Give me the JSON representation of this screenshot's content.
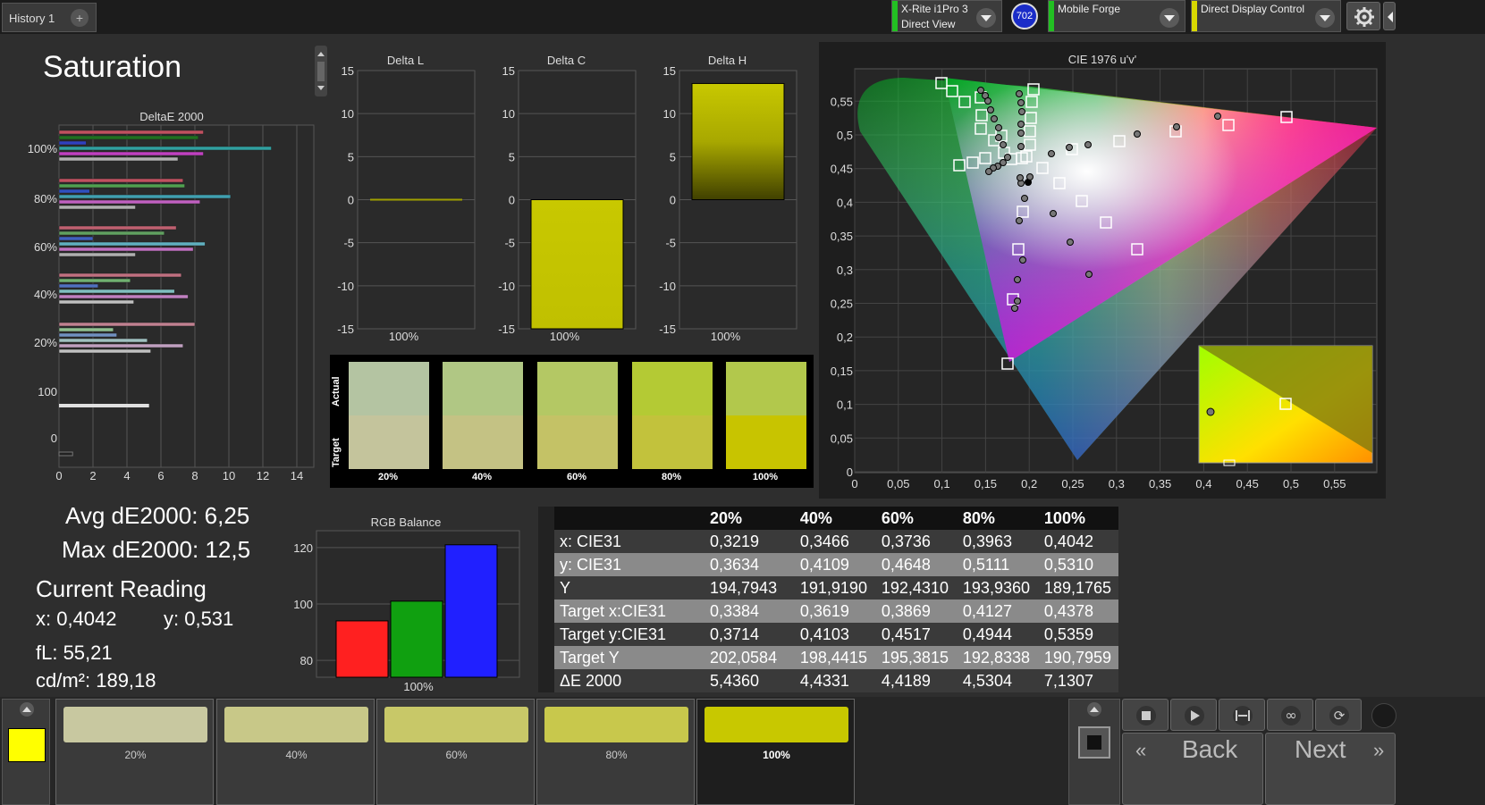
{
  "tabs": {
    "history": "History 1",
    "add": "+"
  },
  "devices": [
    {
      "line1": "X-Rite i1Pro 3",
      "line2": "Direct View",
      "color": "#22c022"
    },
    {
      "line1": "Mobile Forge",
      "line2": "",
      "color": "#22c022"
    },
    {
      "line1": "Direct Display Control",
      "line2": "",
      "color": "#d8d800"
    }
  ],
  "badge": "702",
  "icons": {
    "settings": "gear-icon",
    "collapse": "chevron-left-icon"
  },
  "page_title": "Saturation",
  "deltae_chart": {
    "title": "DeltaE 2000",
    "ylabels": [
      "100%",
      "80%",
      "60%",
      "40%",
      "20%",
      "100",
      "0"
    ],
    "xticks": [
      "0",
      "2",
      "4",
      "6",
      "8",
      "10",
      "12",
      "14"
    ]
  },
  "delta_charts": [
    {
      "title": "Delta L",
      "value": 0,
      "label": "100%"
    },
    {
      "title": "Delta C",
      "value": -15,
      "label": "100%"
    },
    {
      "title": "Delta H",
      "value": 13.5,
      "label": "100%"
    }
  ],
  "delta_ticks": [
    "15",
    "10",
    "5",
    "0",
    "-5",
    "-10",
    "-15"
  ],
  "swatch_compare": {
    "actual_label": "Actual",
    "target_label": "Target",
    "items": [
      {
        "label": "20%",
        "actual": "#b4c4a2",
        "target": "#c4c49c"
      },
      {
        "label": "40%",
        "actual": "#b0c784",
        "target": "#c4c284"
      },
      {
        "label": "60%",
        "actual": "#b4c864",
        "target": "#c4c266"
      },
      {
        "label": "80%",
        "actual": "#b4ca34",
        "target": "#c2c23c"
      },
      {
        "label": "100%",
        "actual": "#b2c84c",
        "target": "#c8c400"
      }
    ]
  },
  "cie": {
    "title": "CIE 1976 u'v'",
    "yticks": [
      "0,55",
      "0,5",
      "0,45",
      "0,4",
      "0,35",
      "0,3",
      "0,25",
      "0,2",
      "0,15",
      "0,1",
      "0,05",
      "0"
    ],
    "xticks": [
      "0",
      "0,05",
      "0,1",
      "0,15",
      "0,2",
      "0,25",
      "0,3",
      "0,35",
      "0,4",
      "0,45",
      "0,5",
      "0,55"
    ]
  },
  "stats": {
    "avg": "Avg dE2000: 6,25",
    "max": "Max dE2000: 12,5",
    "current_reading": "Current Reading",
    "x": "x: 0,4042",
    "y": "y: 0,531",
    "fl": "fL: 55,21",
    "cdm2": "cd/m²: 189,18"
  },
  "rgb_balance": {
    "title": "RGB Balance",
    "yticks": [
      "120",
      "100",
      "80"
    ],
    "label": "100%",
    "values": [
      {
        "name": "R",
        "value": 94,
        "color": "#ff2020"
      },
      {
        "name": "G",
        "value": 101,
        "color": "#10a010"
      },
      {
        "name": "B",
        "value": 121,
        "color": "#2020ff"
      }
    ]
  },
  "table": {
    "headers": [
      "",
      "20%",
      "40%",
      "60%",
      "80%",
      "100%"
    ],
    "rows": [
      [
        "x: CIE31",
        "0,3219",
        "0,3466",
        "0,3736",
        "0,3963",
        "0,4042"
      ],
      [
        "y: CIE31",
        "0,3634",
        "0,4109",
        "0,4648",
        "0,5111",
        "0,5310"
      ],
      [
        "Y",
        "194,7943",
        "191,9190",
        "192,4310",
        "193,9360",
        "189,1765"
      ],
      [
        "Target x:CIE31",
        "0,3384",
        "0,3619",
        "0,3869",
        "0,4127",
        "0,4378"
      ],
      [
        "Target y:CIE31",
        "0,3714",
        "0,4103",
        "0,4517",
        "0,4944",
        "0,5359"
      ],
      [
        "Target Y",
        "202,0584",
        "198,4415",
        "195,3815",
        "192,8338",
        "190,7959"
      ],
      [
        "ΔE 2000",
        "5,4360",
        "4,4331",
        "4,4189",
        "4,5304",
        "7,1307"
      ]
    ]
  },
  "bottom_swatches": [
    {
      "label": "20%",
      "color": "#c8c8a0"
    },
    {
      "label": "40%",
      "color": "#c8c888"
    },
    {
      "label": "60%",
      "color": "#c8c868"
    },
    {
      "label": "80%",
      "color": "#c8c84c"
    },
    {
      "label": "100%",
      "color": "#c8c800"
    }
  ],
  "current_color": "#ffff00",
  "nav": {
    "back": "Back",
    "next": "Next"
  }
}
